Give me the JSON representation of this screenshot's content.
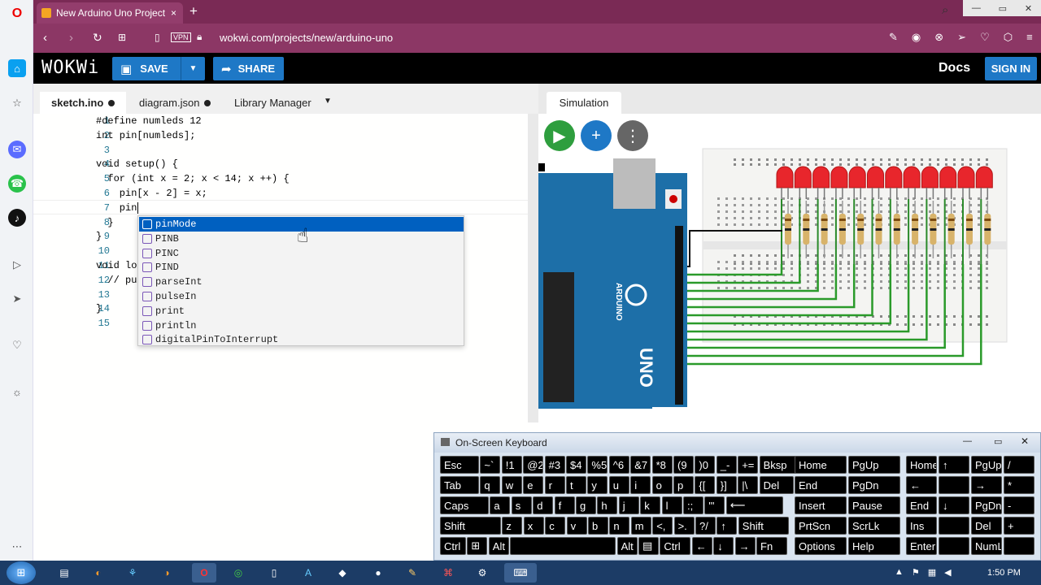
{
  "browser": {
    "tab_title": "New Arduino Uno Project",
    "url": "wokwi.com/projects/new/arduino-uno",
    "brand_color": "#7a2a55"
  },
  "wokwi": {
    "logo": "WOKWi",
    "save_label": "SAVE",
    "share_label": "SHARE",
    "docs_label": "Docs",
    "signin_label": "SIGN IN"
  },
  "editor": {
    "tabs": [
      {
        "label": "sketch.ino",
        "modified": true
      },
      {
        "label": "diagram.json",
        "modified": true
      },
      {
        "label": "Library Manager",
        "modified": false
      }
    ],
    "line_numbers": [
      "1",
      "2",
      "3",
      "4",
      "5",
      "6",
      "7",
      "8",
      "9",
      "10",
      "11",
      "12",
      "13",
      "14",
      "15"
    ],
    "lines": [
      "#define numleds 12",
      "int pin[numleds];",
      "",
      "void setup() {",
      "  for (int x = 2; x < 14; x ++) {",
      "    pin[x - 2] = x;",
      "    pin",
      "  }",
      "}",
      "",
      "void lo",
      "  // pu",
      "",
      "}",
      ""
    ]
  },
  "autocomplete": {
    "items": [
      "pinMode",
      "PINB",
      "PINC",
      "PIND",
      "parseInt",
      "pulseIn",
      "print",
      "println",
      "digitalPinToInterrupt"
    ],
    "selected_index": 0
  },
  "simulation": {
    "tab_label": "Simulation",
    "board_label": "UNO",
    "board_brand": "ARDUINO"
  },
  "keyboard": {
    "title": "On-Screen Keyboard",
    "rows": [
      [
        "Esc",
        "~`",
        "!1",
        "@2",
        "#3",
        "$4",
        "%5",
        "^6",
        "&7",
        "*8",
        "(9",
        ")0",
        "_-",
        "+=",
        "Bksp"
      ],
      [
        "Tab",
        "q",
        "w",
        "e",
        "r",
        "t",
        "y",
        "u",
        "i",
        "o",
        "p",
        "{[",
        "}]",
        "|\\",
        "Del"
      ],
      [
        "Caps",
        "a",
        "s",
        "d",
        "f",
        "g",
        "h",
        "j",
        "k",
        "l",
        ":;",
        "\"'",
        "⟵"
      ],
      [
        "Shift",
        "z",
        "x",
        "c",
        "v",
        "b",
        "n",
        "m",
        "<,",
        ">.",
        "?/",
        "↑",
        "Shift"
      ],
      [
        "Ctrl",
        "⊞",
        "Alt",
        "",
        "Alt",
        "▤",
        "Ctrl",
        "←",
        "↓",
        "→",
        "Fn"
      ]
    ],
    "nav_keys": [
      "Home",
      "PgUp",
      "End",
      "PgDn",
      "Insert",
      "Pause",
      "PrtScn",
      "ScrLk",
      "Options",
      "Help"
    ],
    "numpad_keys": [
      "Home",
      "↑",
      "PgUp",
      "/",
      "←",
      "",
      "→",
      "*",
      "End",
      "↓",
      "PgDn",
      "-",
      "Ins",
      "",
      "Del",
      "+",
      "Enter",
      "",
      "NumLock",
      ""
    ]
  },
  "taskbar": {
    "clock": "1:50 PM"
  }
}
